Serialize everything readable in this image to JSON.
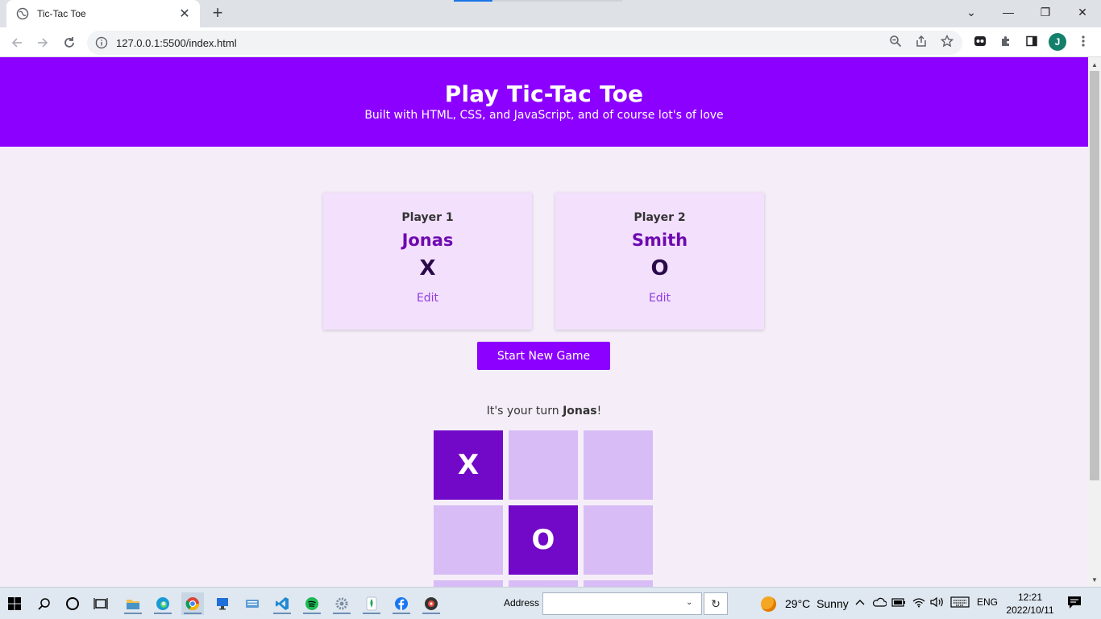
{
  "browser": {
    "tab_title": "Tic-Tac Toe",
    "tab_close": "✕",
    "new_tab": "+",
    "url": "127.0.0.1:5500/index.html",
    "profile_initial": "J",
    "window_controls": [
      "⌄",
      "—",
      "❐",
      "✕"
    ]
  },
  "page": {
    "title": "Play Tic-Tac Toe",
    "subtitle": "Built with HTML, CSS, and JavaScript, and of course lot's of love",
    "players": [
      {
        "label": "Player 1",
        "name": "Jonas",
        "symbol": "X",
        "edit_label": "Edit"
      },
      {
        "label": "Player 2",
        "name": "Smith",
        "symbol": "O",
        "edit_label": "Edit"
      }
    ],
    "start_button": "Start New Game",
    "turn_prefix": "It's your turn ",
    "turn_player": "Jonas",
    "turn_suffix": "!",
    "board": [
      "X",
      "",
      "",
      "",
      "O",
      "",
      "",
      "",
      ""
    ]
  },
  "taskbar": {
    "address_label": "Address",
    "weather_temp": "29°C",
    "weather_text": "Sunny",
    "language": "ENG",
    "time": "12:21",
    "date": "2022/10/11"
  },
  "colors": {
    "accent": "#8b00ff",
    "cell_empty": "#d8bcf6",
    "cell_filled": "#7209c9",
    "card_bg": "#f3e0fd",
    "page_bg": "#f5eef8"
  }
}
